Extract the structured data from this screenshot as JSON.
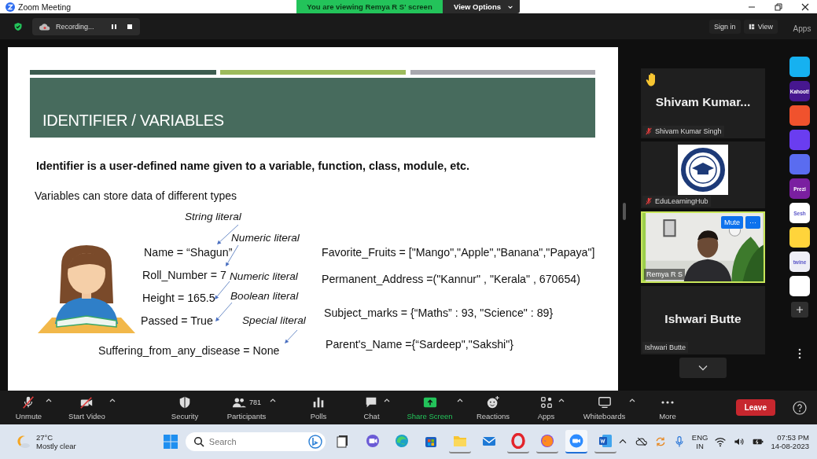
{
  "window": {
    "title": "Zoom Meeting",
    "banner": "You are viewing Remya R S' screen",
    "view_options": "View Options"
  },
  "top_bar": {
    "recording": "Recording...",
    "sign_in": "Sign in",
    "view": "View",
    "apps": "Apps"
  },
  "slide": {
    "title": "IDENTIFIER / VARIABLES",
    "definition": "Identifier is a user-defined name given to a variable, function, class, module, etc.",
    "intro": "Variables can store data of different types",
    "assignments": [
      "Name = “Shagun”",
      "Roll_Number = 7",
      "Height = 165.5",
      "Passed = True",
      "Suffering_from_any_disease = None"
    ],
    "literals": [
      "String literal",
      "Numeric literal",
      "Numeric literal",
      "Boolean literal",
      "Special literal"
    ],
    "collections": [
      "Favorite_Fruits = [\"Mango\",\"Apple\",\"Banana\",\"Papaya\"]",
      "Permanent_Address =(\"Kannur\" , \"Kerala\" , 670654)",
      "Subject_marks = {“Maths” : 93, \"Science\" : 89}",
      "Parent's_Name ={“Sardeep\",\"Sakshi\"}"
    ]
  },
  "participants": [
    {
      "kind": "name_card",
      "display_name": "Shivam Kumar...",
      "name_tag": "Shivam Kumar Singh",
      "muted": true,
      "hand_raised": true,
      "active_speaker": false
    },
    {
      "kind": "logo",
      "name_tag": "EduLearningHub",
      "muted": true,
      "hand_raised": false,
      "active_speaker": false
    },
    {
      "kind": "video",
      "name_tag": "Remya R S",
      "muted": false,
      "hand_raised": false,
      "active_speaker": true,
      "buttons": [
        "Mute",
        "···"
      ]
    },
    {
      "kind": "name_card",
      "display_name": "Ishwari Butte",
      "name_tag": "Ishwari Butte",
      "muted": false,
      "hand_raised": false,
      "active_speaker": false
    }
  ],
  "apps": [
    {
      "color": "#16b1f0"
    },
    {
      "label": "Kahoot!",
      "color": "#46178f"
    },
    {
      "color": "#f0522d"
    },
    {
      "color": "#6a3df0"
    },
    {
      "color": "#5a6cf0"
    },
    {
      "label": "Prezi",
      "color": "#7a1fa0"
    },
    {
      "label": "Sesh",
      "color": "#ffffff"
    },
    {
      "color": "#ffd43b"
    },
    {
      "label": "twine",
      "color": "#eeeef6"
    },
    {
      "color": "#ffffff"
    }
  ],
  "toolbar": [
    {
      "label": "Unmute",
      "menu": true,
      "highlighted": false
    },
    {
      "label": "Start Video",
      "menu": true,
      "highlighted": false
    },
    {
      "label": "Security",
      "menu": false,
      "highlighted": false
    },
    {
      "label": "Participants",
      "count": "781",
      "menu": true,
      "highlighted": false
    },
    {
      "label": "Polls",
      "menu": false,
      "highlighted": false
    },
    {
      "label": "Chat",
      "menu": true,
      "highlighted": false
    },
    {
      "label": "Share Screen",
      "menu": true,
      "highlighted": true
    },
    {
      "label": "Reactions",
      "menu": false,
      "highlighted": false
    },
    {
      "label": "Apps",
      "menu": true,
      "highlighted": false
    },
    {
      "label": "Whiteboards",
      "menu": true,
      "highlighted": false
    },
    {
      "label": "More",
      "menu": false,
      "highlighted": false
    }
  ],
  "leave": "Leave",
  "taskbar": {
    "temperature": "27°C",
    "weather": "Mostly clear",
    "search_placeholder": "Search",
    "apps": [
      {
        "running": false,
        "active": false
      },
      {
        "running": false,
        "active": false
      },
      {
        "running": false,
        "active": false
      },
      {
        "running": false,
        "active": false
      },
      {
        "running": true,
        "active": false
      },
      {
        "running": false,
        "active": false
      },
      {
        "running": true,
        "active": false
      },
      {
        "running": true,
        "active": false
      },
      {
        "running": true,
        "active": true
      },
      {
        "running": true,
        "active": false
      }
    ],
    "language": "ENG",
    "region": "IN",
    "time": "07:53 PM",
    "date": "14-08-2023"
  }
}
